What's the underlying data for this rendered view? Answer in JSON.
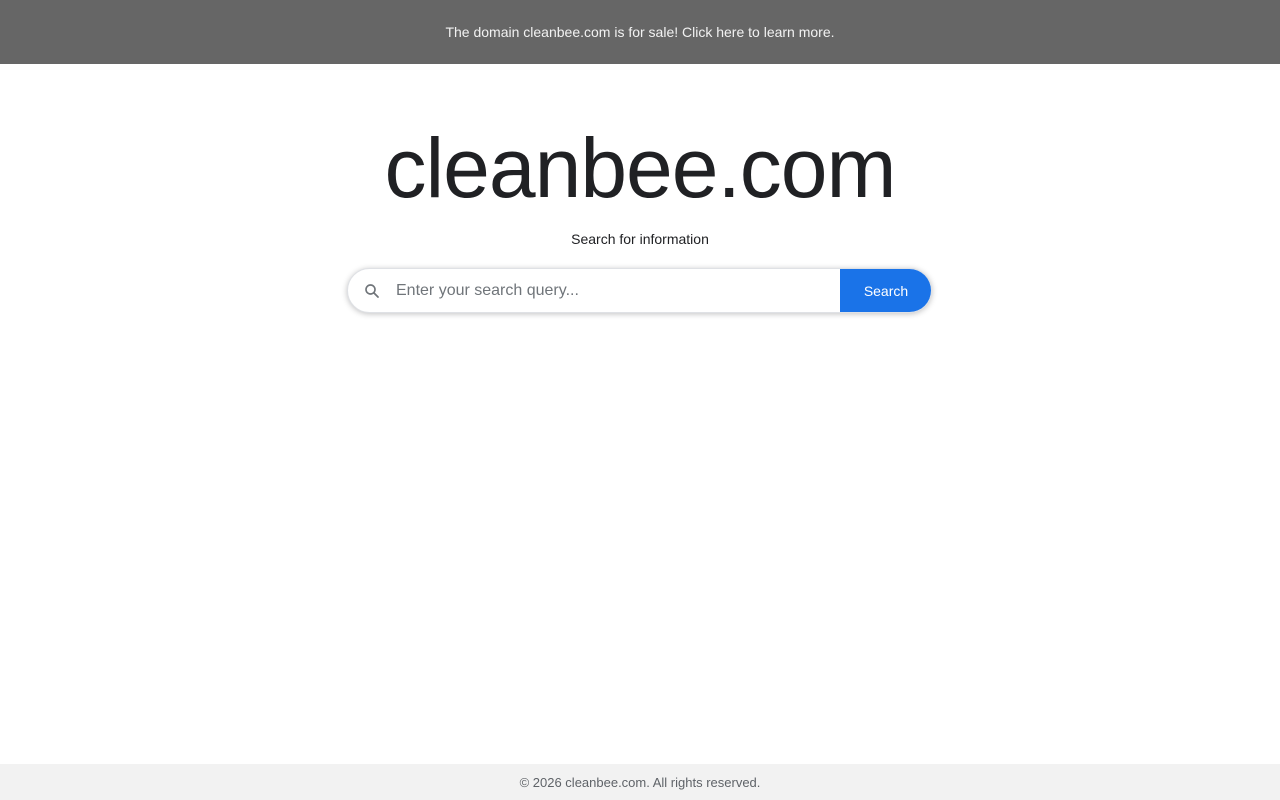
{
  "banner": {
    "text": "The domain cleanbee.com is for sale! Click here to learn more.",
    "background": "#666666"
  },
  "header": {
    "title": "cleanbee.com",
    "subtitle": "Search for information"
  },
  "search": {
    "icon": "search-icon",
    "value": "",
    "placeholder": "Enter your search query...",
    "button_label": "Search",
    "button_color": "#1a73e8"
  },
  "footer": {
    "text": "© 2026 cleanbee.com. All rights reserved."
  }
}
